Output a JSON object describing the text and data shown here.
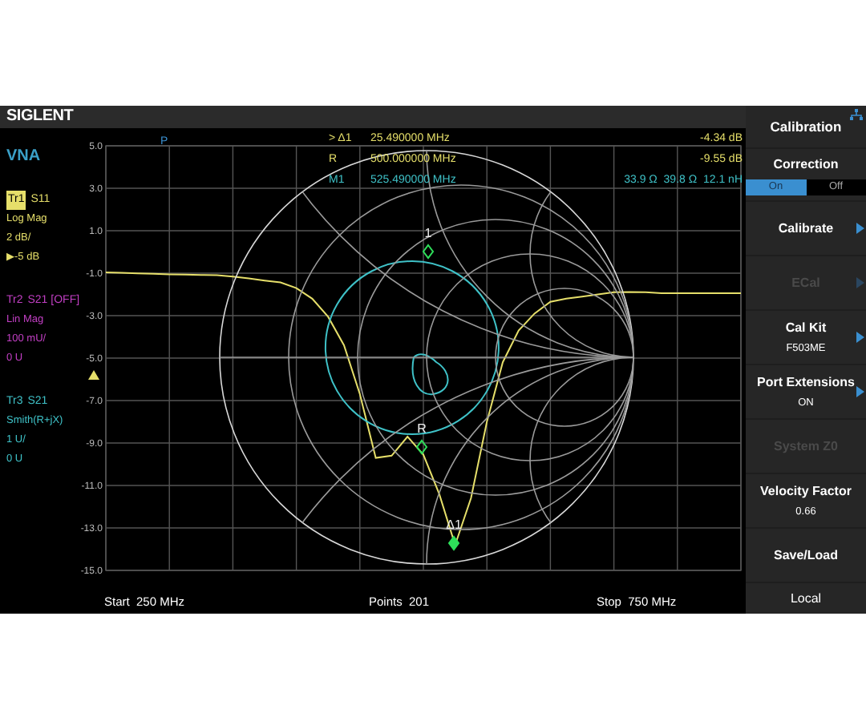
{
  "brand": "SIGLENT",
  "mode": "VNA",
  "channel_flag": "P",
  "traces": [
    {
      "label": "Tr1",
      "param": "S11",
      "active": true,
      "color": "#e6df6a",
      "lines": [
        "Log Mag",
        "2 dB/",
        "▶-5 dB"
      ]
    },
    {
      "label": "Tr2",
      "param": "S21 [OFF]",
      "active": false,
      "color": "#c23fc4",
      "lines": [
        "Lin Mag",
        "100 mU/",
        "0 U"
      ]
    },
    {
      "label": "Tr3",
      "param": "S21",
      "active": false,
      "color": "#3fc2c8",
      "lines": [
        "Smith(R+jX)",
        "1 U/",
        "0 U"
      ]
    }
  ],
  "chart_data": {
    "type": "line",
    "grid": true,
    "ylim": [
      -15,
      5
    ],
    "yticks": [
      {
        "value": 5,
        "label": "5.0"
      },
      {
        "value": 3,
        "label": "3.0"
      },
      {
        "value": 1,
        "label": "1.0"
      },
      {
        "value": -1,
        "label": "-1.0"
      },
      {
        "value": -3,
        "label": "-3.0"
      },
      {
        "value": -5,
        "label": "-5.0"
      },
      {
        "value": -7,
        "label": "-7.0"
      },
      {
        "value": -9,
        "label": "-9.0"
      },
      {
        "value": -11,
        "label": "-11.0"
      },
      {
        "value": -13,
        "label": "-13.0"
      },
      {
        "value": -15,
        "label": "-15.0"
      }
    ],
    "categories": [
      null,
      null,
      null,
      null,
      null,
      null,
      null,
      null,
      null,
      null,
      null,
      null,
      null,
      null,
      null,
      null,
      null,
      null,
      null,
      null,
      null,
      null,
      null,
      null,
      null,
      null,
      null,
      null,
      null,
      null,
      null,
      null,
      null,
      null,
      null,
      null,
      null,
      null,
      null,
      null,
      null
    ],
    "series": [
      {
        "color": "#e6df6a",
        "values": [
          -0.96,
          -0.98,
          -1.01,
          -1.03,
          -1.05,
          -1.07,
          -1.08,
          -1.1,
          -1.16,
          -1.25,
          -1.35,
          -1.44,
          -1.7,
          -2.2,
          -3.05,
          -4.4,
          -6.7,
          -9.7,
          -9.6,
          -8.7,
          -9.55,
          -11.4,
          -13.8,
          -11.6,
          -8.0,
          -5.2,
          -3.7,
          -2.9,
          -2.35,
          -2.2,
          -2.1,
          -2.0,
          -1.9,
          -1.88,
          -1.9,
          -1.94,
          -1.94,
          -1.94,
          -1.94,
          -1.94,
          -1.94
        ]
      }
    ]
  },
  "markers": [
    {
      "label": "> Δ1",
      "frequency": "25.490000 MHz",
      "reading": "-4.34 dB",
      "color": "#e6df6a"
    },
    {
      "label": "R",
      "frequency": "500.000000 MHz",
      "reading": "-9.55 dB",
      "color": "#e6df6a"
    },
    {
      "label": "M1",
      "frequency": "525.490000 MHz",
      "reading": "33.9 Ω  39.8 Ω  12.1 nH",
      "color": "#3fc2c8"
    }
  ],
  "plot_marker_labels": [
    "1",
    "R",
    "Δ1"
  ],
  "footer": {
    "start": "Start  250 MHz",
    "points": "Points  201",
    "stop": "Stop  750 MHz"
  },
  "menu": {
    "title": "Calibration",
    "items": [
      {
        "kind": "toggle",
        "label": "Correction",
        "options": [
          {
            "label": "On",
            "selected": true
          },
          {
            "label": "Off",
            "selected": false
          }
        ]
      },
      {
        "kind": "button",
        "label": "Calibrate",
        "arrow": true,
        "disabled": false
      },
      {
        "kind": "button",
        "label": "ECal",
        "arrow": true,
        "disabled": true
      },
      {
        "kind": "button",
        "label": "Cal Kit",
        "value": "F503ME",
        "arrow": true,
        "disabled": false
      },
      {
        "kind": "button",
        "label": "Port Extensions",
        "value": "ON",
        "arrow": true,
        "disabled": false
      },
      {
        "kind": "button",
        "label": "System Z0",
        "arrow": false,
        "disabled": true
      },
      {
        "kind": "button",
        "label": "Velocity Factor",
        "value": "0.66",
        "arrow": false,
        "disabled": false
      },
      {
        "kind": "button",
        "label": "Save/Load",
        "arrow": false,
        "disabled": false
      }
    ],
    "footer": "Local"
  }
}
